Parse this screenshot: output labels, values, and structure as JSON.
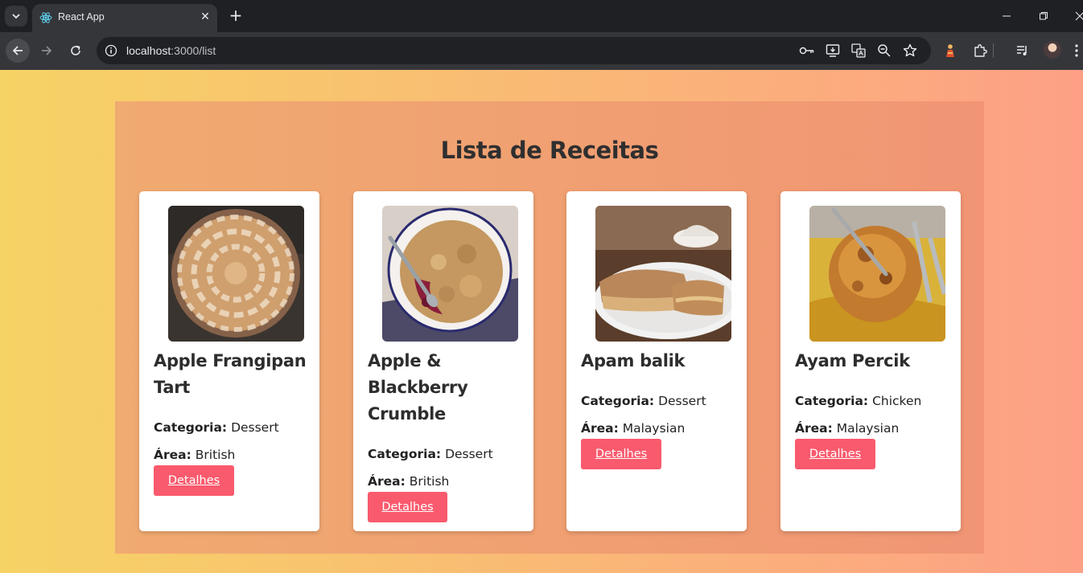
{
  "browser": {
    "tab_title": "React App",
    "url_host": "localhost",
    "url_path": ":3000/list"
  },
  "page": {
    "title": "Lista de Receitas",
    "category_label": "Categoria:",
    "area_label": "Área:",
    "details_label": "Detalhes",
    "recipes": [
      {
        "name": "Apple Frangipan Tart",
        "category": "Dessert",
        "area": "British",
        "image": "apple-tart-photo"
      },
      {
        "name": "Apple & Blackberry Crumble",
        "category": "Dessert",
        "area": "British",
        "image": "crumble-photo"
      },
      {
        "name": "Apam balik",
        "category": "Dessert",
        "area": "Malaysian",
        "image": "apam-balik-photo"
      },
      {
        "name": "Ayam Percik",
        "category": "Chicken",
        "area": "Malaysian",
        "image": "ayam-percik-photo"
      }
    ]
  },
  "colors": {
    "gradient_start": "#f6d365",
    "gradient_end": "#fda085",
    "button": "#f95a6d"
  }
}
